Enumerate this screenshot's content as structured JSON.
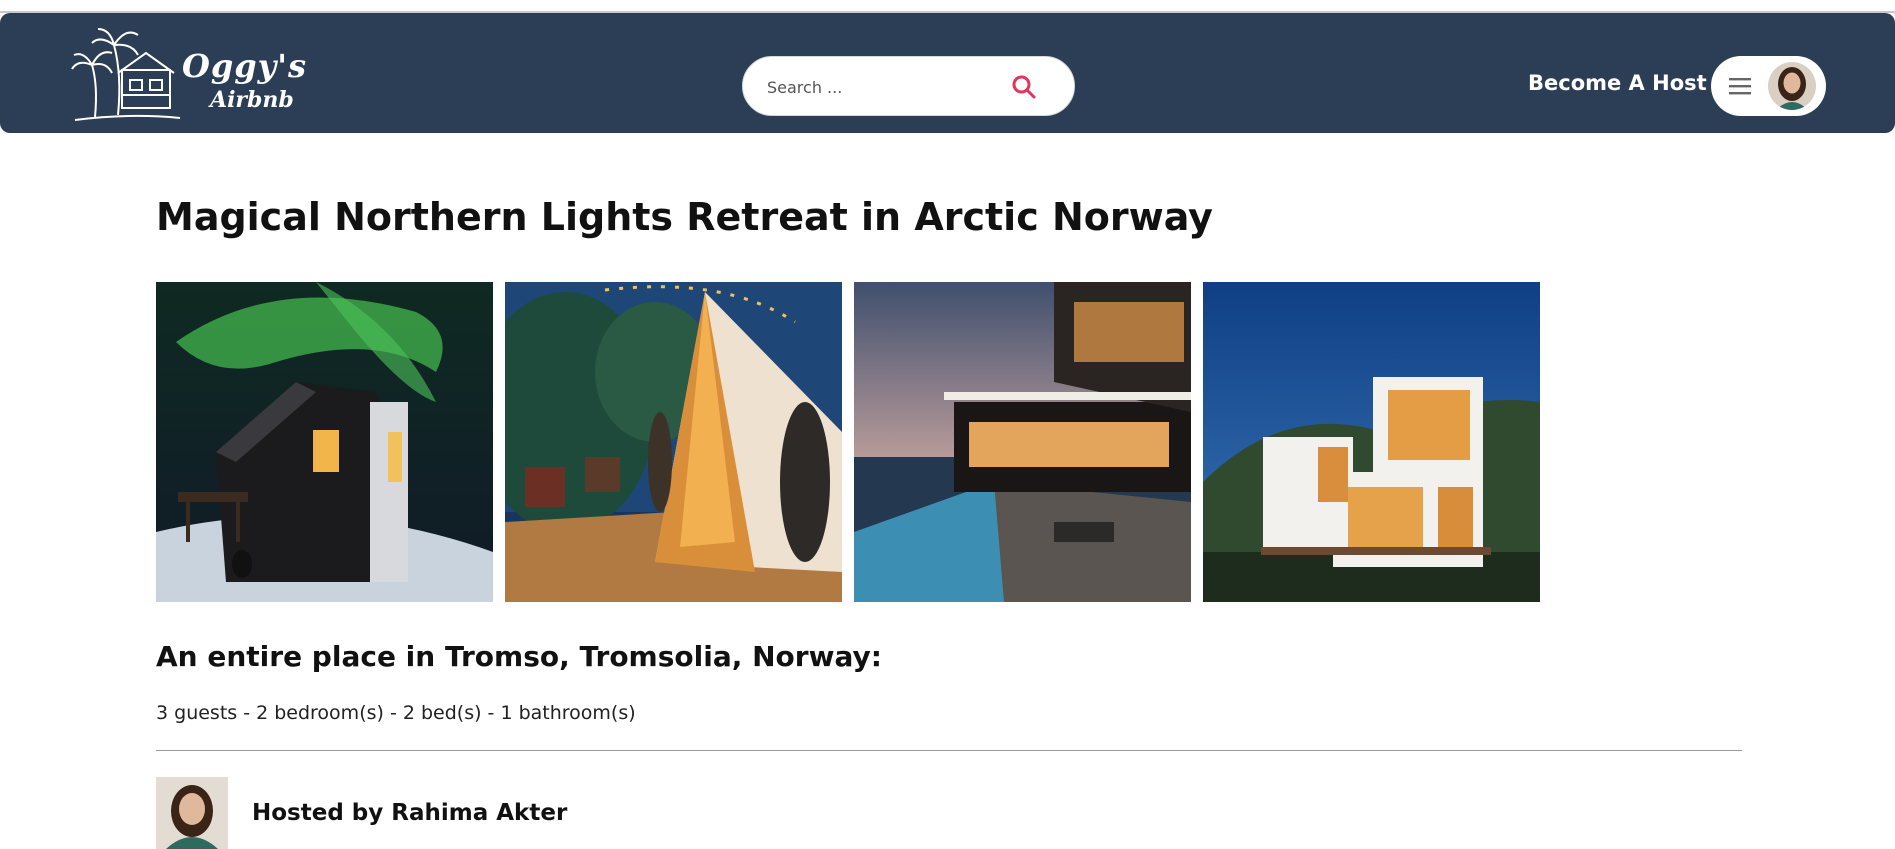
{
  "header": {
    "logo_line1": "Oggy's",
    "logo_line2": "Airbnb",
    "search_placeholder": "Search ...",
    "become_host_label": "Become A Host",
    "accent_color": "#e8325a",
    "navbar_color": "#2c3e56"
  },
  "listing": {
    "title": "Magical Northern Lights Retreat in Arctic Norway",
    "photos": [
      {
        "icon": "aurora-cabin-photo"
      },
      {
        "icon": "glamping-tent-photo"
      },
      {
        "icon": "modern-villa-pool-photo"
      },
      {
        "icon": "cube-house-photo"
      }
    ],
    "place_heading": "An entire place in Tromso, Tromsolia, Norway:",
    "details": "3 guests - 2 bedroom(s) - 2 bed(s) - 1 bathroom(s)",
    "host_label": "Hosted by Rahima Akter"
  }
}
